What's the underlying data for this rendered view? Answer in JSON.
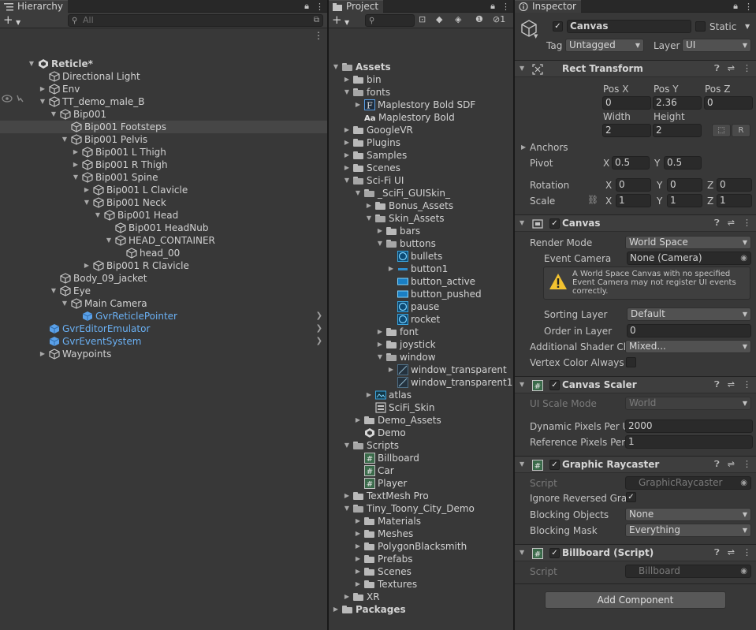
{
  "hierarchy": {
    "tab_title": "Hierarchy",
    "search_placeholder": "All",
    "items": [
      {
        "label": "Reticle*",
        "depth": 0,
        "arrow": "open",
        "icon": "unity-scene-icon",
        "bold": true
      },
      {
        "label": "Directional Light",
        "depth": 1,
        "arrow": "",
        "icon": "gameobject-icon"
      },
      {
        "label": "Env",
        "depth": 1,
        "arrow": "closed",
        "icon": "gameobject-icon"
      },
      {
        "label": "TT_demo_male_B",
        "depth": 1,
        "arrow": "open",
        "icon": "gameobject-icon"
      },
      {
        "label": "Bip001",
        "depth": 2,
        "arrow": "open",
        "icon": "gameobject-icon"
      },
      {
        "label": "Bip001 Footsteps",
        "depth": 3,
        "arrow": "",
        "icon": "gameobject-icon",
        "selected": true
      },
      {
        "label": "Bip001 Pelvis",
        "depth": 3,
        "arrow": "open",
        "icon": "gameobject-icon"
      },
      {
        "label": "Bip001 L Thigh",
        "depth": 4,
        "arrow": "closed",
        "icon": "gameobject-icon"
      },
      {
        "label": "Bip001 R Thigh",
        "depth": 4,
        "arrow": "closed",
        "icon": "gameobject-icon"
      },
      {
        "label": "Bip001 Spine",
        "depth": 4,
        "arrow": "open",
        "icon": "gameobject-icon"
      },
      {
        "label": "Bip001 L Clavicle",
        "depth": 5,
        "arrow": "closed",
        "icon": "gameobject-icon"
      },
      {
        "label": "Bip001 Neck",
        "depth": 5,
        "arrow": "open",
        "icon": "gameobject-icon"
      },
      {
        "label": "Bip001 Head",
        "depth": 6,
        "arrow": "open",
        "icon": "gameobject-icon"
      },
      {
        "label": "Bip001 HeadNub",
        "depth": 7,
        "arrow": "",
        "icon": "gameobject-icon"
      },
      {
        "label": "HEAD_CONTAINER",
        "depth": 7,
        "arrow": "open",
        "icon": "gameobject-icon"
      },
      {
        "label": "head_00",
        "depth": 8,
        "arrow": "",
        "icon": "gameobject-icon"
      },
      {
        "label": "Bip001 R Clavicle",
        "depth": 5,
        "arrow": "closed",
        "icon": "gameobject-icon"
      },
      {
        "label": "Body_09_jacket",
        "depth": 2,
        "arrow": "",
        "icon": "gameobject-icon"
      },
      {
        "label": "Eye",
        "depth": 2,
        "arrow": "open",
        "icon": "gameobject-icon"
      },
      {
        "label": "Main Camera",
        "depth": 3,
        "arrow": "open",
        "icon": "gameobject-icon"
      },
      {
        "label": "GvrReticlePointer",
        "depth": 4,
        "arrow": "",
        "icon": "prefab-icon",
        "blue": true,
        "chevron": true
      },
      {
        "label": "GvrEditorEmulator",
        "depth": 1,
        "arrow": "",
        "icon": "prefab-icon",
        "blue": true,
        "chevron": true
      },
      {
        "label": "GvrEventSystem",
        "depth": 1,
        "arrow": "",
        "icon": "prefab-icon",
        "blue": true,
        "chevron": true
      },
      {
        "label": "Waypoints",
        "depth": 1,
        "arrow": "closed",
        "icon": "gameobject-icon"
      }
    ]
  },
  "project": {
    "tab_title": "Project",
    "toolbar_count": "1",
    "items": [
      {
        "label": "Assets",
        "depth": 0,
        "arrow": "open",
        "icon": "folder-open-icon",
        "bold": true
      },
      {
        "label": "bin",
        "depth": 1,
        "arrow": "closed",
        "icon": "folder-icon"
      },
      {
        "label": "fonts",
        "depth": 1,
        "arrow": "open",
        "icon": "folder-open-icon"
      },
      {
        "label": "Maplestory Bold SDF",
        "depth": 2,
        "arrow": "closed",
        "icon": "font-asset-icon"
      },
      {
        "label": "Maplestory Bold",
        "depth": 2,
        "arrow": "",
        "icon": "font-icon"
      },
      {
        "label": "GoogleVR",
        "depth": 1,
        "arrow": "closed",
        "icon": "folder-icon"
      },
      {
        "label": "Plugins",
        "depth": 1,
        "arrow": "closed",
        "icon": "folder-icon"
      },
      {
        "label": "Samples",
        "depth": 1,
        "arrow": "closed",
        "icon": "folder-icon"
      },
      {
        "label": "Scenes",
        "depth": 1,
        "arrow": "closed",
        "icon": "folder-icon"
      },
      {
        "label": "Sci-Fi UI",
        "depth": 1,
        "arrow": "open",
        "icon": "folder-open-icon"
      },
      {
        "label": "_SciFi_GUISkin_",
        "depth": 2,
        "arrow": "open",
        "icon": "folder-open-icon"
      },
      {
        "label": "Bonus_Assets",
        "depth": 3,
        "arrow": "closed",
        "icon": "folder-icon"
      },
      {
        "label": "Skin_Assets",
        "depth": 3,
        "arrow": "open",
        "icon": "folder-open-icon"
      },
      {
        "label": "bars",
        "depth": 4,
        "arrow": "closed",
        "icon": "folder-icon"
      },
      {
        "label": "buttons",
        "depth": 4,
        "arrow": "open",
        "icon": "folder-open-icon"
      },
      {
        "label": "bullets",
        "depth": 5,
        "arrow": "",
        "icon": "sprite-round-icon"
      },
      {
        "label": "button1",
        "depth": 5,
        "arrow": "closed",
        "icon": "sprite-bar-icon"
      },
      {
        "label": "button_active",
        "depth": 5,
        "arrow": "",
        "icon": "sprite-rect-icon"
      },
      {
        "label": "button_pushed",
        "depth": 5,
        "arrow": "",
        "icon": "sprite-rect-icon"
      },
      {
        "label": "pause",
        "depth": 5,
        "arrow": "",
        "icon": "sprite-round-icon"
      },
      {
        "label": "rocket",
        "depth": 5,
        "arrow": "",
        "icon": "sprite-round-icon"
      },
      {
        "label": "font",
        "depth": 4,
        "arrow": "closed",
        "icon": "folder-icon"
      },
      {
        "label": "joystick",
        "depth": 4,
        "arrow": "closed",
        "icon": "folder-icon"
      },
      {
        "label": "window",
        "depth": 4,
        "arrow": "open",
        "icon": "folder-open-icon"
      },
      {
        "label": "window_transparent",
        "depth": 5,
        "arrow": "closed",
        "icon": "sprite-window-icon"
      },
      {
        "label": "window_transparent1",
        "depth": 5,
        "arrow": "",
        "icon": "sprite-window-icon"
      },
      {
        "label": "atlas",
        "depth": 3,
        "arrow": "closed",
        "icon": "atlas-icon"
      },
      {
        "label": "SciFi_Skin",
        "depth": 3,
        "arrow": "",
        "icon": "guiskin-icon"
      },
      {
        "label": "Demo_Assets",
        "depth": 2,
        "arrow": "closed",
        "icon": "folder-icon"
      },
      {
        "label": "Demo",
        "depth": 2,
        "arrow": "",
        "icon": "unity-scene-icon"
      },
      {
        "label": "Scripts",
        "depth": 1,
        "arrow": "open",
        "icon": "folder-open-icon"
      },
      {
        "label": "Billboard",
        "depth": 2,
        "arrow": "",
        "icon": "script-icon"
      },
      {
        "label": "Car",
        "depth": 2,
        "arrow": "",
        "icon": "script-icon"
      },
      {
        "label": "Player",
        "depth": 2,
        "arrow": "",
        "icon": "script-icon"
      },
      {
        "label": "TextMesh Pro",
        "depth": 1,
        "arrow": "closed",
        "icon": "folder-icon"
      },
      {
        "label": "Tiny_Toony_City_Demo",
        "depth": 1,
        "arrow": "open",
        "icon": "folder-open-icon"
      },
      {
        "label": "Materials",
        "depth": 2,
        "arrow": "closed",
        "icon": "folder-icon"
      },
      {
        "label": "Meshes",
        "depth": 2,
        "arrow": "closed",
        "icon": "folder-icon"
      },
      {
        "label": "PolygonBlacksmith",
        "depth": 2,
        "arrow": "closed",
        "icon": "folder-icon"
      },
      {
        "label": "Prefabs",
        "depth": 2,
        "arrow": "closed",
        "icon": "folder-icon"
      },
      {
        "label": "Scenes",
        "depth": 2,
        "arrow": "closed",
        "icon": "folder-icon"
      },
      {
        "label": "Textures",
        "depth": 2,
        "arrow": "closed",
        "icon": "folder-icon"
      },
      {
        "label": "XR",
        "depth": 1,
        "arrow": "closed",
        "icon": "folder-icon"
      },
      {
        "label": "Packages",
        "depth": 0,
        "arrow": "closed",
        "icon": "folder-icon",
        "bold": true
      }
    ]
  },
  "inspector": {
    "tab_title": "Inspector",
    "object_name": "Canvas",
    "static_label": "Static",
    "tag_label": "Tag",
    "tag_value": "Untagged",
    "layer_label": "Layer",
    "layer_value": "UI",
    "rect_transform": {
      "title": "Rect Transform",
      "pos_x_label": "Pos X",
      "pos_x": "0",
      "pos_y_label": "Pos Y",
      "pos_y": "2.36",
      "pos_z_label": "Pos Z",
      "pos_z": "0",
      "width_label": "Width",
      "width": "2",
      "height_label": "Height",
      "height": "2",
      "r_button": "R",
      "anchors_label": "Anchors",
      "pivot_label": "Pivot",
      "pivot_x": "0.5",
      "pivot_y": "0.5",
      "rotation_label": "Rotation",
      "rot_x": "0",
      "rot_y": "0",
      "rot_z": "0",
      "scale_label": "Scale",
      "scale_x": "1",
      "scale_y": "1",
      "scale_z": "1",
      "x": "X",
      "y": "Y",
      "z": "Z"
    },
    "canvas": {
      "title": "Canvas",
      "render_mode_label": "Render Mode",
      "render_mode": "World Space",
      "event_camera_label": "Event Camera",
      "event_camera": "None (Camera)",
      "warning": "A World Space Canvas with no specified Event Camera may not register UI events correctly.",
      "sorting_layer_label": "Sorting Layer",
      "sorting_layer": "Default",
      "order_label": "Order in Layer",
      "order": "0",
      "shader_label": "Additional Shader Ch",
      "shader": "Mixed...",
      "vertex_label": "Vertex Color Always I"
    },
    "canvas_scaler": {
      "title": "Canvas Scaler",
      "ui_scale_label": "UI Scale Mode",
      "ui_scale": "World",
      "dyn_label": "Dynamic Pixels Per U",
      "dyn": "2000",
      "ref_label": "Reference Pixels Per",
      "ref": "1"
    },
    "graphic_raycaster": {
      "title": "Graphic Raycaster",
      "script_label": "Script",
      "script": "GraphicRaycaster",
      "ignore_label": "Ignore Reversed Gra",
      "blocking_label": "Blocking Objects",
      "blocking": "None",
      "mask_label": "Blocking Mask",
      "mask": "Everything"
    },
    "billboard": {
      "title": "Billboard (Script)",
      "script_label": "Script",
      "script": "Billboard"
    },
    "add_component": "Add Component"
  },
  "colors": {
    "panel_bg": "#383838",
    "header_bg": "#3e3e3e",
    "selected_row": "#464646",
    "prefab_blue": "#6ab0f3",
    "text": "#c4c4c4"
  }
}
